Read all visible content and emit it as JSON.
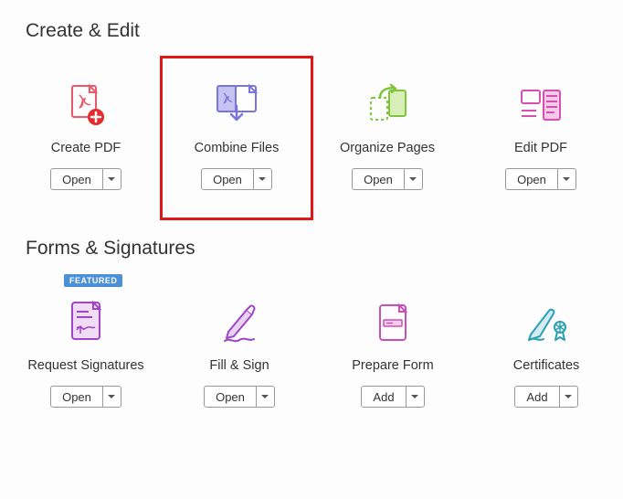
{
  "sections": [
    {
      "title": "Create & Edit",
      "tools": [
        {
          "id": "create-pdf",
          "icon": "create-pdf-icon",
          "label": "Create PDF",
          "button": "Open",
          "highlighted": false
        },
        {
          "id": "combine-files",
          "icon": "combine-files-icon",
          "label": "Combine Files",
          "button": "Open",
          "highlighted": true
        },
        {
          "id": "organize-pages",
          "icon": "organize-pages-icon",
          "label": "Organize Pages",
          "button": "Open",
          "highlighted": false
        },
        {
          "id": "edit-pdf",
          "icon": "edit-pdf-icon",
          "label": "Edit PDF",
          "button": "Open",
          "highlighted": false
        }
      ]
    },
    {
      "title": "Forms & Signatures",
      "tools": [
        {
          "id": "request-signatures",
          "icon": "request-signatures-icon",
          "label": "Request Signatures",
          "button": "Open",
          "badge": "FEATURED"
        },
        {
          "id": "fill-sign",
          "icon": "fill-sign-icon",
          "label": "Fill & Sign",
          "button": "Open"
        },
        {
          "id": "prepare-form",
          "icon": "prepare-form-icon",
          "label": "Prepare Form",
          "button": "Add"
        },
        {
          "id": "certificates",
          "icon": "certificates-icon",
          "label": "Certificates",
          "button": "Add"
        }
      ]
    }
  ]
}
